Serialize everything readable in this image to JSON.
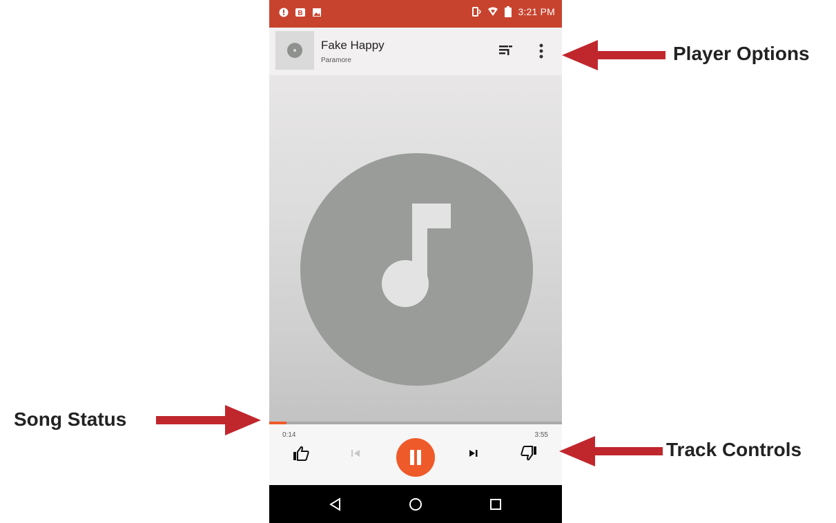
{
  "status_bar": {
    "left_icons": [
      "notification-icon",
      "b-app-icon",
      "image-icon"
    ],
    "right_icons": [
      "vibrate-icon",
      "wifi-icon",
      "battery-icon"
    ],
    "time": "3:21 PM"
  },
  "header": {
    "song_title": "Fake Happy",
    "artist": "Paramore",
    "icons": [
      "queue-icon",
      "more-vert-icon"
    ]
  },
  "player": {
    "album_art_icon": "music-note-icon",
    "current_time": "0:14",
    "total_time": "3:55",
    "progress": 0.06,
    "controls": [
      "thumbs-up-icon",
      "skip-previous-icon",
      "pause-icon",
      "skip-next-icon",
      "thumbs-down-icon"
    ]
  },
  "nav_bar": {
    "icons": [
      "back-icon",
      "home-icon",
      "recents-icon"
    ]
  },
  "callouts": {
    "player_options": "Player Options",
    "song_status": "Song Status",
    "track_controls": "Track Controls"
  },
  "colors": {
    "status_bar": "#c8432e",
    "accent": "#ef5a2a",
    "annotation_arrow": "#c0272d"
  }
}
